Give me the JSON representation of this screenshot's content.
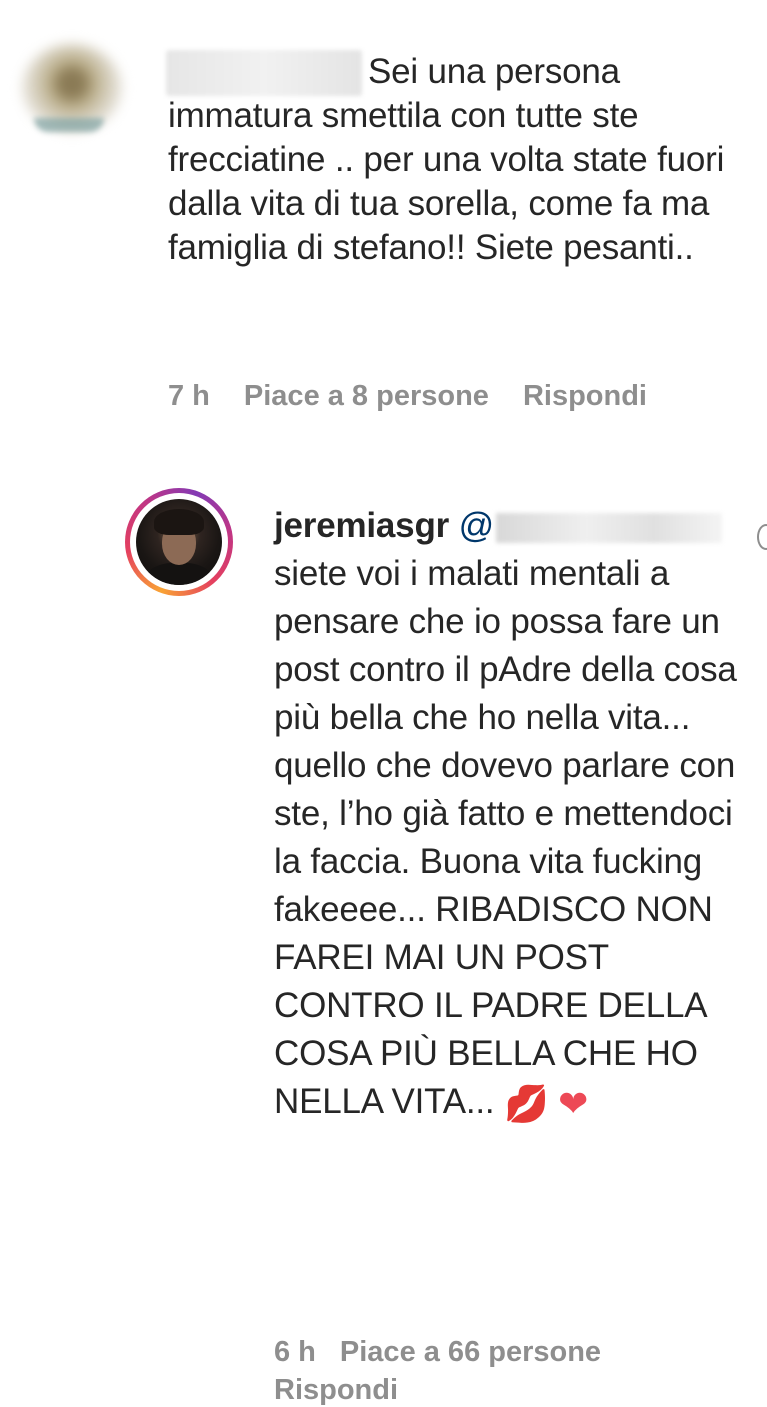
{
  "comments": [
    {
      "username_hidden": true,
      "text": "Sei una persona immatura smettila con tutte ste frecciatine .. per una volta state fuori dalla vita di tua sorella, come fa ma famiglia di stefano!! Siete pesanti..",
      "time": "7 h",
      "likes": "Piace a 8 persone",
      "reply": "Rispondi"
    },
    {
      "username": "jeremiasgr",
      "mention_prefix": "@",
      "text": "siete voi i malati mentali a pensare che io possa fare un post contro il pAdre della cosa più bella che ho nella vita... quello che dovevo parlare con ste, l’ho già fatto e mettendoci la faccia. Buona vita fucking fakeeee... RIBADISCO NON FAREI MAI UN POST CONTRO IL PADRE DELLA COSA PIÙ BELLA CHE HO NELLA VITA...",
      "emoji_1": "💋",
      "emoji_2": "❤",
      "time": "6 h",
      "likes": "Piace a 66 persone",
      "reply": "Rispondi"
    }
  ],
  "icons": {
    "avatar_1": "blurred-avatar",
    "avatar_2": "profile-photo-with-story-ring",
    "emoji_1": "kiss-mark-icon",
    "emoji_2": "heart-icon"
  }
}
